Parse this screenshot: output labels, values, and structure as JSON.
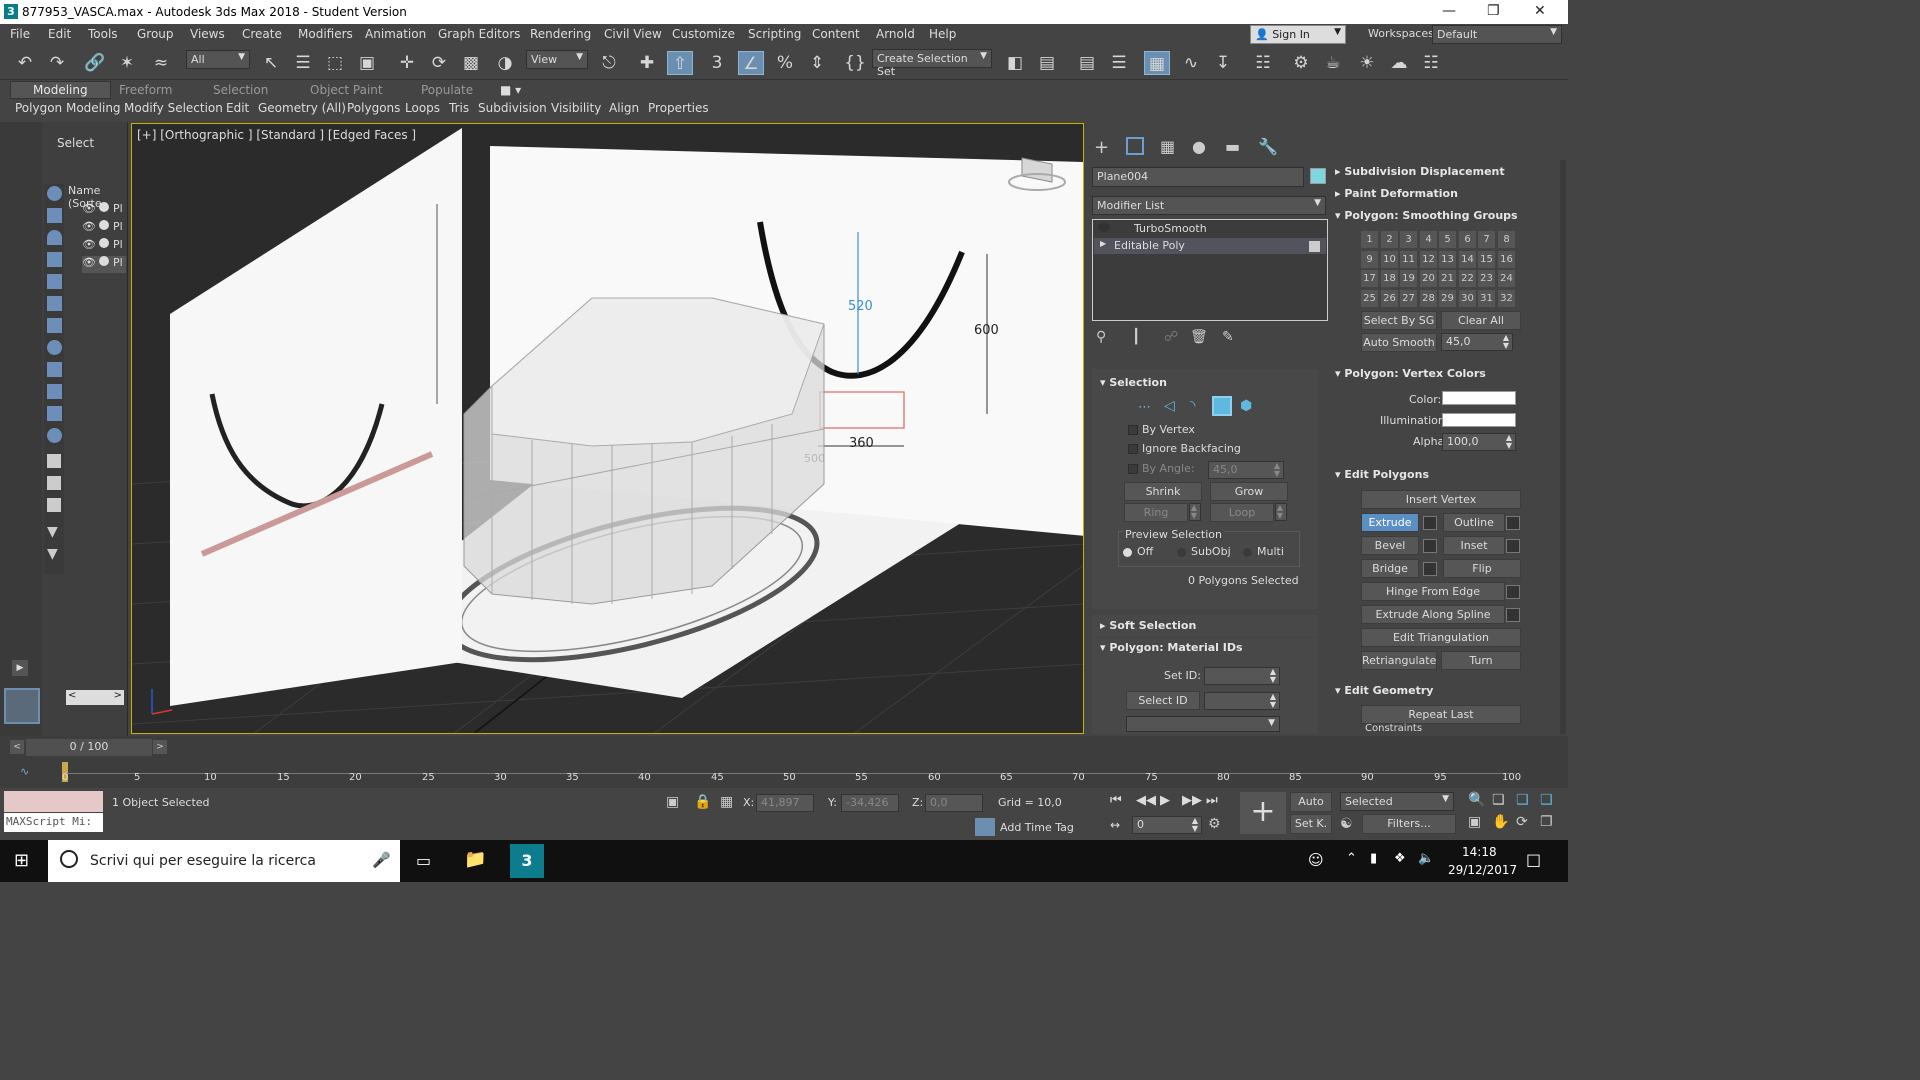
{
  "window": {
    "title": "877953_VASCA.max - Autodesk 3ds Max 2018 - Student Version",
    "app_icon": "3"
  },
  "menu": [
    "File",
    "Edit",
    "Tools",
    "Group",
    "Views",
    "Create",
    "Modifiers",
    "Animation",
    "Graph Editors",
    "Rendering",
    "Civil View",
    "Customize",
    "Scripting",
    "Content",
    "Arnold",
    "Help"
  ],
  "account": {
    "sign_in": "Sign In",
    "workspaces_label": "Workspaces:",
    "workspace": "Default"
  },
  "toolbar": {
    "filter": "All",
    "view": "View",
    "selection_set": "Create Selection Set",
    "snap_num": "3"
  },
  "ribbon": {
    "tabs": [
      "Modeling",
      "Freeform",
      "Selection",
      "Object Paint",
      "Populate"
    ],
    "sub": [
      "Polygon Modeling",
      "Modify Selection",
      "Edit",
      "Geometry (All)",
      "Polygons",
      "Loops",
      "Tris",
      "Subdivision",
      "Visibility",
      "Align",
      "Properties"
    ]
  },
  "scene_explorer": {
    "title": "Select",
    "column": "Name (Sorte",
    "items": [
      "Pl",
      "Pl",
      "Pl",
      "Pl"
    ]
  },
  "viewport": {
    "label": "[+] [Orthographic ] [Standard ] [Edged Faces ]",
    "dim_520": "520",
    "dim_600": "600",
    "dim_360": "360",
    "dim_500": "500"
  },
  "command_panel": {
    "object_name": "Plane004",
    "obj_color": "#7fd6e0",
    "modifier_list": "Modifier List",
    "stack": [
      "TurboSmooth",
      "Editable Poly"
    ],
    "selection": {
      "title": "Selection",
      "by_vertex": "By Vertex",
      "ignore_backfacing": "Ignore Backfacing",
      "by_angle": "By Angle:",
      "angle": "45,0",
      "shrink": "Shrink",
      "grow": "Grow",
      "ring": "Ring",
      "loop": "Loop",
      "preview": "Preview Selection",
      "off": "Off",
      "subobj": "SubObj",
      "multi": "Multi",
      "status": "0 Polygons Selected"
    },
    "soft_selection": "Soft Selection",
    "material_ids": {
      "title": "Polygon: Material IDs",
      "set_id": "Set ID:",
      "select_id": "Select ID"
    }
  },
  "right_panel": {
    "subdiv_disp": "Subdivision Displacement",
    "paint_def": "Paint Deformation",
    "smoothing": "Polygon: Smoothing Groups",
    "sg": [
      "1",
      "2",
      "3",
      "4",
      "5",
      "6",
      "7",
      "8",
      "9",
      "10",
      "11",
      "12",
      "13",
      "14",
      "15",
      "16",
      "17",
      "18",
      "19",
      "20",
      "21",
      "22",
      "23",
      "24",
      "25",
      "26",
      "27",
      "28",
      "29",
      "30",
      "31",
      "32"
    ],
    "select_by_sg": "Select By SG",
    "clear_all": "Clear All",
    "auto_smooth": "Auto Smooth",
    "auto_smooth_val": "45,0",
    "vertex_colors": "Polygon: Vertex Colors",
    "color": "Color:",
    "illumination": "Illumination:",
    "alpha": "Alpha:",
    "alpha_val": "100,0",
    "edit_polygons": "Edit Polygons",
    "insert_vertex": "Insert Vertex",
    "extrude": "Extrude",
    "outline": "Outline",
    "bevel": "Bevel",
    "inset": "Inset",
    "bridge": "Bridge",
    "flip": "Flip",
    "hinge": "Hinge From Edge",
    "extrude_spline": "Extrude Along Spline",
    "edit_tri": "Edit Triangulation",
    "retriangulate": "Retriangulate",
    "turn": "Turn",
    "edit_geometry": "Edit Geometry",
    "repeat_last": "Repeat Last",
    "constraints": "Constraints"
  },
  "timeline": {
    "frame": "0 / 100",
    "ticks": [
      "0",
      "5",
      "10",
      "15",
      "20",
      "25",
      "30",
      "35",
      "40",
      "45",
      "50",
      "55",
      "60",
      "65",
      "70",
      "75",
      "80",
      "85",
      "90",
      "95",
      "100"
    ]
  },
  "status": {
    "objects": "1 Object Selected",
    "maxscript": "MAXScript Mi:",
    "x_label": "X:",
    "x": "41,897",
    "y_label": "Y:",
    "y": "-34,426",
    "z_label": "Z:",
    "z": "0,0",
    "grid": "Grid = 10,0",
    "add_time_tag": "Add Time Tag",
    "auto": "Auto",
    "setk": "Set K.",
    "selected": "Selected",
    "filters": "Filters...",
    "frame_field": "0"
  },
  "taskbar": {
    "search": "Scrivi qui per eseguire la ricerca",
    "time": "14:18",
    "date": "29/12/2017"
  }
}
